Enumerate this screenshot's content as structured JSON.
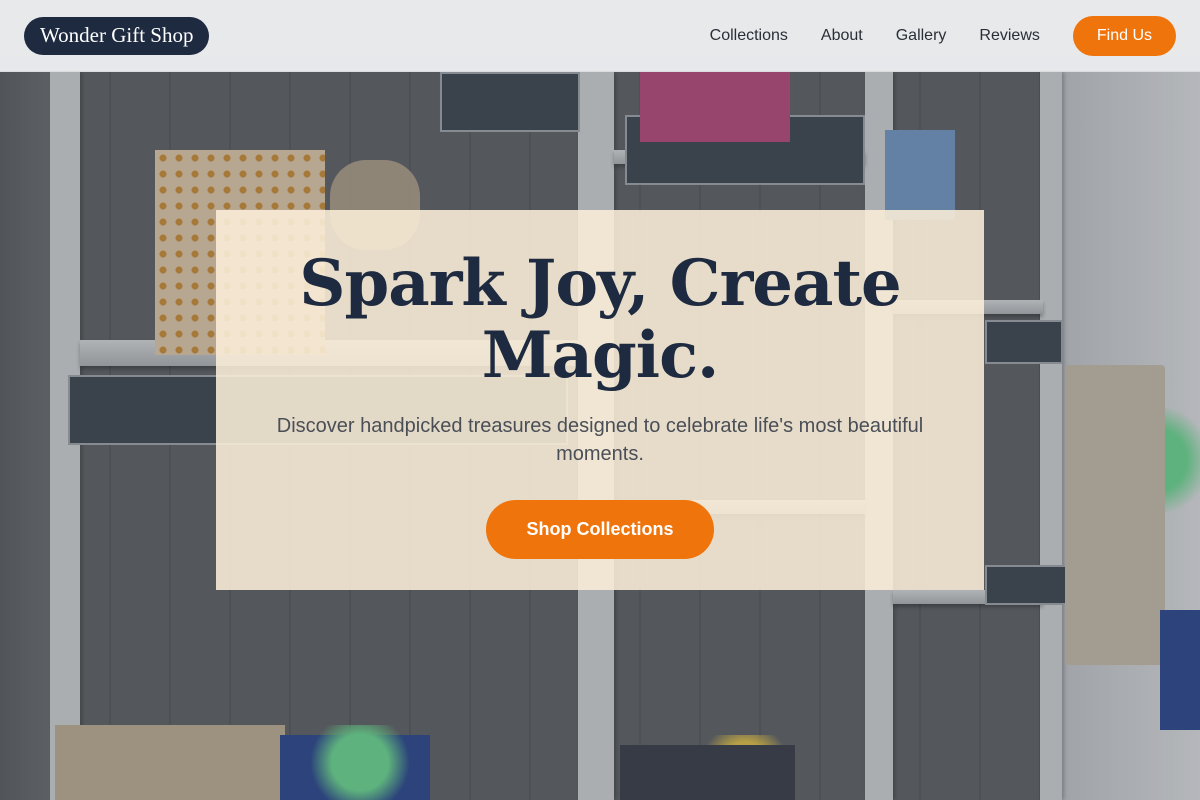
{
  "brand": {
    "name": "Wonder Gift Shop"
  },
  "nav": {
    "links": [
      "Collections",
      "About",
      "Gallery",
      "Reviews"
    ],
    "cta": "Find Us"
  },
  "hero": {
    "title": "Spark Joy, Create Magic.",
    "subtitle": "Discover handpicked treasures designed to celebrate life's most beautiful moments.",
    "cta": "Shop Collections"
  },
  "colors": {
    "brand_navy": "#1e2a40",
    "accent_orange": "#f0740c",
    "card_cream": "#fbeed8"
  }
}
